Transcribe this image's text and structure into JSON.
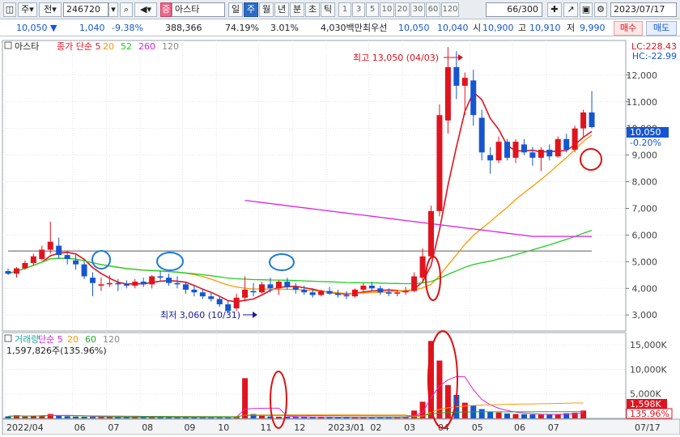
{
  "toolbar": {
    "market_type": "주",
    "period_label": "전",
    "stock_code": "246720",
    "stock_badge": "중",
    "stock_name": "아스타",
    "period_tabs": [
      {
        "label": "일",
        "selected": false
      },
      {
        "label": "주",
        "selected": true
      },
      {
        "label": "월",
        "selected": false
      },
      {
        "label": "년",
        "selected": false
      },
      {
        "label": "분",
        "selected": false
      },
      {
        "label": "초",
        "selected": false
      },
      {
        "label": "틱",
        "selected": false
      }
    ],
    "intervals": [
      "1",
      "3",
      "5",
      "10",
      "20",
      "30",
      "60",
      "120"
    ],
    "count": "66",
    "count_total": "/300",
    "date": "2023/07/17"
  },
  "quote": {
    "price": "10,050",
    "change_arrow": "▼",
    "change": "1,040",
    "change_pct": "-9.38%",
    "volume": "388,366",
    "volume_ratio": "74.19%",
    "turnover": "3.01%",
    "amount": "4,030백만",
    "priority_label": "최우선",
    "ask": "10,050",
    "bid": "10,040",
    "open_label": "시",
    "open": "10,900",
    "high_label": "고",
    "high": "10,910",
    "low_label": "저",
    "low": "9,990",
    "buy_label": "매수",
    "sell_label": "매도",
    "colors": {
      "up": "#e0141e",
      "down": "#1556d0"
    }
  },
  "price_panel": {
    "title": "아스타",
    "legend": [
      {
        "text": "종가 단순 5",
        "color": "#e0141e"
      },
      {
        "text": "20",
        "color": "#ff9900"
      },
      {
        "text": "52",
        "color": "#22cc22"
      },
      {
        "text": "260",
        "color": "#dd22dd"
      },
      {
        "text": "120",
        "color": "#888888"
      }
    ],
    "lc": "LC:228.43",
    "hc": "HC:-22.99",
    "current_price_label": "10,050",
    "current_change_label": "-0.20%",
    "high_annotation": "최고 13,050 (04/03)",
    "low_annotation": "최저 3,060 (10/31)"
  },
  "volume_panel": {
    "legend": [
      {
        "text": "거래량",
        "color": "#22aa99"
      },
      {
        "text": "단순 5",
        "color": "#dd22dd"
      },
      {
        "text": "20",
        "color": "#ff9900"
      },
      {
        "text": "60",
        "color": "#22aa22"
      },
      {
        "text": "120",
        "color": "#888888"
      }
    ],
    "info": "1,597,826주(135.96%)",
    "current_volume_label": "1,598K",
    "current_volume_pct": "135.96%"
  },
  "chart_data": {
    "type": "candlestick",
    "weeks": 67,
    "price_axis": {
      "ticks": [
        3000,
        4000,
        5000,
        6000,
        7000,
        8000,
        9000,
        10000,
        11000,
        12000
      ],
      "tick_labels": [
        "3,000",
        "4,000",
        "5,000",
        "6,000",
        "7,000",
        "8,000",
        "9,000",
        "10,000",
        "11,000",
        "12,000"
      ],
      "range": [
        2400,
        13300
      ]
    },
    "volume_axis": {
      "ticks": [
        5000,
        10000,
        15000
      ],
      "tick_labels": [
        "5,000K",
        "10,000K",
        "15,000K"
      ],
      "range": [
        0,
        17500
      ]
    },
    "x_labels": [
      {
        "label": "2022/04",
        "week": 0
      },
      {
        "label": "06",
        "week": 8
      },
      {
        "label": "07",
        "week": 12
      },
      {
        "label": "08",
        "week": 16
      },
      {
        "label": "09",
        "week": 21
      },
      {
        "label": "10",
        "week": 25
      },
      {
        "label": "11",
        "week": 30
      },
      {
        "label": "12",
        "week": 34
      },
      {
        "label": "2023/01",
        "week": 38
      },
      {
        "label": "02",
        "week": 43
      },
      {
        "label": "03",
        "week": 47
      },
      {
        "label": "04",
        "week": 51
      },
      {
        "label": "05",
        "week": 55
      },
      {
        "label": "06",
        "week": 60
      },
      {
        "label": "07",
        "week": 64
      },
      {
        "label": "07/17",
        "week": 71
      }
    ],
    "candles": [
      [
        4650,
        4750,
        4500,
        4550
      ],
      [
        4550,
        4800,
        4400,
        4750
      ],
      [
        4750,
        5050,
        4700,
        4950
      ],
      [
        4950,
        5300,
        4850,
        5200
      ],
      [
        5100,
        5600,
        5050,
        5450
      ],
      [
        5450,
        6500,
        5300,
        5750
      ],
      [
        5600,
        5900,
        5100,
        5250
      ],
      [
        5250,
        5400,
        4900,
        5100
      ],
      [
        5050,
        5250,
        4700,
        4900
      ],
      [
        4900,
        5000,
        4350,
        4450
      ],
      [
        4400,
        4600,
        3700,
        4200
      ],
      [
        4100,
        4400,
        3900,
        4150
      ],
      [
        4150,
        4500,
        4050,
        4200
      ],
      [
        4200,
        4350,
        3900,
        4150
      ],
      [
        4150,
        4300,
        4000,
        4100
      ],
      [
        4100,
        4350,
        4000,
        4250
      ],
      [
        4250,
        4400,
        4050,
        4150
      ],
      [
        4150,
        4500,
        4000,
        4450
      ],
      [
        4450,
        4650,
        4300,
        4400
      ],
      [
        4400,
        4550,
        4100,
        4200
      ],
      [
        4200,
        4450,
        4000,
        4150
      ],
      [
        4150,
        4250,
        3800,
        3950
      ],
      [
        3950,
        4100,
        3700,
        3850
      ],
      [
        3850,
        3950,
        3600,
        3700
      ],
      [
        3700,
        3850,
        3500,
        3600
      ],
      [
        3600,
        3700,
        3300,
        3400
      ],
      [
        3400,
        3550,
        3060,
        3150
      ],
      [
        3250,
        3800,
        3150,
        3650
      ],
      [
        3650,
        4450,
        3500,
        3950
      ],
      [
        3900,
        4200,
        3700,
        3850
      ],
      [
        3850,
        4250,
        3800,
        4150
      ],
      [
        4150,
        4400,
        3850,
        4000
      ],
      [
        4000,
        4300,
        3750,
        4250
      ],
      [
        4250,
        4400,
        3950,
        4050
      ],
      [
        4050,
        4200,
        3800,
        3950
      ],
      [
        3950,
        4100,
        3750,
        3850
      ],
      [
        3850,
        4000,
        3650,
        3750
      ],
      [
        3750,
        3950,
        3700,
        3900
      ],
      [
        3900,
        4050,
        3750,
        3800
      ],
      [
        3800,
        3950,
        3650,
        3750
      ],
      [
        3750,
        3900,
        3600,
        3700
      ],
      [
        3700,
        4000,
        3650,
        3950
      ],
      [
        3950,
        4200,
        3850,
        4100
      ],
      [
        4100,
        4250,
        3900,
        4000
      ],
      [
        4000,
        4100,
        3750,
        3850
      ],
      [
        3850,
        4000,
        3700,
        3800
      ],
      [
        3800,
        3950,
        3700,
        3850
      ],
      [
        3850,
        4050,
        3750,
        3900
      ],
      [
        3900,
        4600,
        3850,
        4450
      ],
      [
        4400,
        5500,
        4300,
        5200
      ],
      [
        5200,
        7100,
        5100,
        6900
      ],
      [
        6900,
        10900,
        6700,
        10500
      ],
      [
        10300,
        13050,
        9800,
        12300
      ],
      [
        12300,
        12900,
        11100,
        11600
      ],
      [
        11600,
        12100,
        10500,
        11900
      ],
      [
        11800,
        12200,
        10100,
        10500
      ],
      [
        10400,
        10700,
        8800,
        9100
      ],
      [
        9000,
        9300,
        8300,
        8800
      ],
      [
        8800,
        9700,
        8700,
        9500
      ],
      [
        9500,
        9600,
        8800,
        8900
      ],
      [
        8900,
        9600,
        8700,
        9500
      ],
      [
        9400,
        9600,
        9000,
        9100
      ],
      [
        9100,
        9300,
        8600,
        8900
      ],
      [
        8900,
        9300,
        8400,
        9200
      ],
      [
        9200,
        9400,
        8800,
        8950
      ],
      [
        8950,
        9700,
        8900,
        9600
      ],
      [
        9600,
        9800,
        9100,
        9200
      ],
      [
        9200,
        10100,
        9100,
        10000
      ],
      [
        10000,
        10700,
        9700,
        10600
      ],
      [
        10600,
        11400,
        10000,
        10050
      ]
    ],
    "volumes": [
      420,
      650,
      380,
      520,
      610,
      900,
      560,
      430,
      360,
      330,
      300,
      280,
      260,
      250,
      240,
      300,
      260,
      280,
      250,
      230,
      220,
      240,
      260,
      230,
      220,
      260,
      300,
      420,
      8200,
      900,
      520,
      400,
      350,
      320,
      300,
      280,
      260,
      250,
      240,
      230,
      220,
      210,
      230,
      250,
      220,
      210,
      230,
      260,
      1600,
      3400,
      15800,
      11800,
      6800,
      4800,
      3200,
      2600,
      1900,
      1400,
      1200,
      1000,
      900,
      850,
      800,
      780,
      760,
      900,
      1050,
      1150,
      1598
    ],
    "moving_averages": [
      {
        "name": "5",
        "color": "#e0141e",
        "start": 4
      },
      {
        "name": "20",
        "color": "#ff9900",
        "start": 0
      },
      {
        "name": "52",
        "color": "#22cc22",
        "start": 0
      },
      {
        "name": "120",
        "color": "#888888",
        "start": 0
      },
      {
        "name": "260",
        "color": "#dd22dd",
        "start": 28
      }
    ]
  }
}
